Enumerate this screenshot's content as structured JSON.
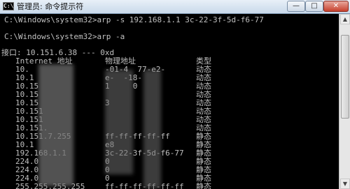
{
  "window": {
    "title": "管理员: 命令提示符",
    "app_icon": "C:\\",
    "controls": {
      "minimize": "—",
      "maximize": "□",
      "close": "✕"
    }
  },
  "console": {
    "cmd1": "C:\\Windows\\system32>arp -s 192.168.1.1 3c-22-3f-5d-f6-77",
    "cmd2": "C:\\Windows\\system32>arp -a",
    "interface_line": "接口: 10.151.6.38 --- 0xd",
    "headers": {
      "internet": "Internet 地址",
      "physical": "物理地址",
      "type": "类型"
    },
    "rows": [
      {
        "ip": "10.",
        "mac": "-01-4  77-e2-",
        "type": "动态"
      },
      {
        "ip": "10.1",
        "mac": "e-  -18-",
        "type": "动态"
      },
      {
        "ip": "10.15",
        "mac": "1     0",
        "type": "动态"
      },
      {
        "ip": "10.15",
        "mac": "",
        "type": "动态"
      },
      {
        "ip": "10.15",
        "mac": "3",
        "type": "动态"
      },
      {
        "ip": "10.151",
        "mac": "",
        "type": "动态"
      },
      {
        "ip": "10.151",
        "mac": "",
        "type": "动态"
      },
      {
        "ip": "10.151.",
        "mac": "",
        "type": "动态"
      },
      {
        "ip": "10.151.7.255",
        "mac": "ff-ff-ff-ff-ff",
        "type": "静态"
      },
      {
        "ip": "10.1",
        "mac": "e8",
        "type": "静态"
      },
      {
        "ip": "192.168.1.1",
        "mac": "3c-22-3f-5d-f6-77",
        "type": "静态"
      },
      {
        "ip": "224.0",
        "mac": "0",
        "type": "静态"
      },
      {
        "ip": "224.0",
        "mac": "0",
        "type": "静态"
      },
      {
        "ip": "224.0",
        "mac": "0",
        "type": "静态"
      },
      {
        "ip": "255.255.255.255",
        "mac": "ff-ff-ff-ff-ff-ff",
        "type": "静态"
      }
    ]
  },
  "scrollbar": {
    "up": "▲",
    "down": "▼"
  },
  "colors": {
    "console_bg": "#000000",
    "console_text": "#c0c0c0"
  }
}
